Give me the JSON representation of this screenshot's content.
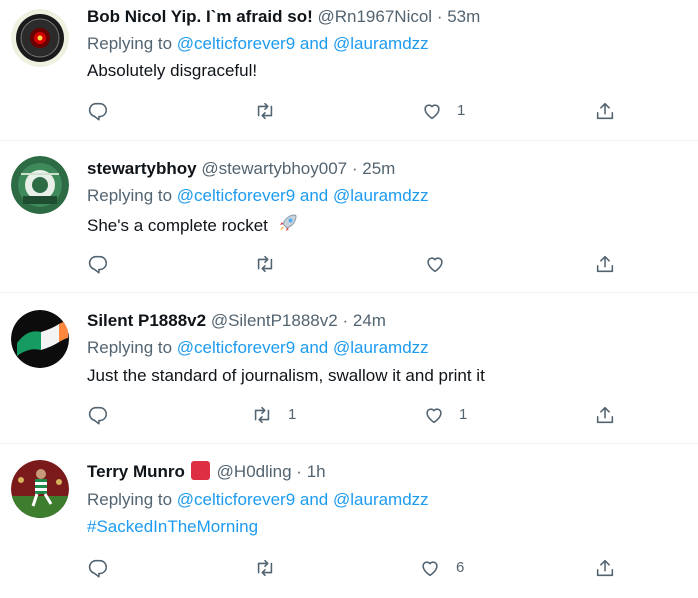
{
  "tweets": [
    {
      "name": "Bob Nicol Yip. I`m afraid so!",
      "handle": "@Rn1967Nicol",
      "dot": "·",
      "time": "53m",
      "replying_prefix": "Replying to",
      "replying_to_1": "@celticforever9",
      "replying_and": "and",
      "replying_to_2": "@lauramdzz",
      "text": "Absolutely disgraceful!",
      "retweets": "",
      "likes": "1"
    },
    {
      "name": "stewartybhoy",
      "handle": "@stewartybhoy007",
      "dot": "·",
      "time": "25m",
      "replying_prefix": "Replying to",
      "replying_to_1": "@celticforever9",
      "replying_and": "and",
      "replying_to_2": "@lauramdzz",
      "text": "She's a complete rocket",
      "retweets": "",
      "likes": ""
    },
    {
      "name": "Silent P1888v2",
      "handle": "@SilentP1888v2",
      "dot": "·",
      "time": "24m",
      "replying_prefix": "Replying to",
      "replying_to_1": "@celticforever9",
      "replying_and": "and",
      "replying_to_2": "@lauramdzz",
      "text": "Just the standard of journalism, swallow it and print it",
      "retweets": "1",
      "likes": "1"
    },
    {
      "name": "Terry Munro",
      "handle": "@H0dling",
      "dot": "·",
      "time": "1h",
      "replying_prefix": "Replying to",
      "replying_to_1": "@celticforever9",
      "replying_and": "and",
      "replying_to_2": "@lauramdzz",
      "text": "#SackedInTheMorning",
      "retweets": "",
      "likes": "6"
    }
  ],
  "icons": {
    "reply": "reply-icon",
    "retweet": "retweet-icon",
    "like": "like-icon",
    "share": "share-icon",
    "rocket": "rocket-emoji",
    "badge": "red-square-emoji"
  },
  "colors": {
    "link": "#1d9bf0",
    "secondary": "#536471",
    "text": "#0f1419",
    "divider": "#eff3f4"
  }
}
